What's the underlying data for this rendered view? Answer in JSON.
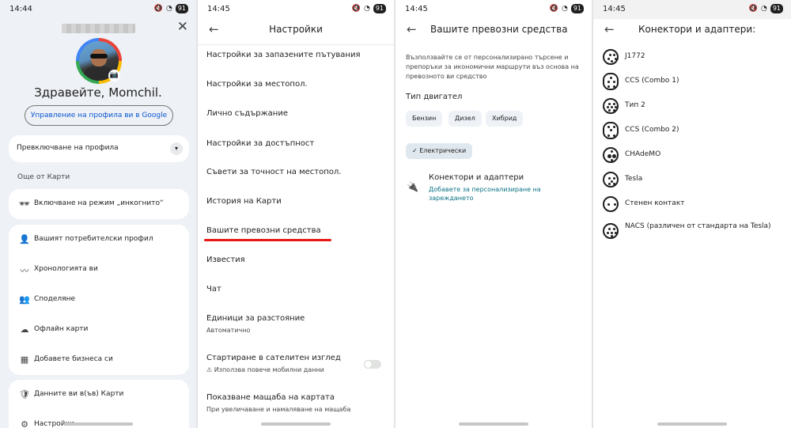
{
  "panel1": {
    "status": {
      "time": "14:44",
      "battery": "91"
    },
    "greeting": "Здравейте, Momchil.",
    "manage_profile": "Управление на профила ви в Google",
    "switch_profile": "Превключване на профила",
    "more_from_maps": "Още от Карти",
    "incognito": "Включване на режим „инкогнито“",
    "menu_a": [
      {
        "icon": "person-icon",
        "glyph": "👤",
        "label": "Вашият потребителски профил"
      },
      {
        "icon": "timeline-icon",
        "glyph": "〰",
        "label": "Хронологията ви"
      },
      {
        "icon": "share-people-icon",
        "glyph": "👥",
        "label": "Споделяне"
      },
      {
        "icon": "offline-cloud-icon",
        "glyph": "☁",
        "label": "Офлайн карти"
      },
      {
        "icon": "store-icon",
        "glyph": "▦",
        "label": "Добавете бизнеса си"
      }
    ],
    "menu_b": [
      {
        "icon": "shield-icon",
        "glyph": "🛡",
        "label": "Данните ви в(ъв) Карти"
      },
      {
        "icon": "gear-icon",
        "glyph": "⚙",
        "label": "Настройки"
      }
    ]
  },
  "panel2": {
    "status": {
      "time": "14:45",
      "battery": "91"
    },
    "title": "Настройки",
    "items": [
      "Настройки за запазените пътувания",
      "Настройки за местопол.",
      "Лично съдържание",
      "Настройки за достъпност",
      "Съвети за точност на местопол.",
      "История на Карти",
      "Вашите превозни средства",
      "Известия",
      "Чат"
    ],
    "distance_units": "Единици за разстояние",
    "distance_units_value": "Автоматично",
    "satellite": "Стартиране в сателитен изглед",
    "satellite_sub": "⚠ Използва повече мобилни данни",
    "satellite_on": false,
    "scale": "Показване мащаба на картата",
    "scale_sub": "При увеличаване и намаляване на мащаба"
  },
  "panel3": {
    "status": {
      "time": "14:45",
      "battery": "91"
    },
    "title": "Вашите превозни средства",
    "description": "Възползвайте се от персонализирано търсене и препоръки за икономични маршрути въз основа на превозното ви средство",
    "engine_type": "Тип двигател",
    "chips": [
      "Бензин",
      "Дизел",
      "Хибрид"
    ],
    "electric": "✓ Електрически",
    "connectors_title": "Конектори и адаптери",
    "connectors_link": "Добавете за персонализиране на зареждането"
  },
  "panel4": {
    "status": {
      "time": "14:45",
      "battery": "91"
    },
    "title": "Конектори и адаптери:",
    "connectors": [
      "J1772",
      "CCS (Combo 1)",
      "Тип 2",
      "CCS (Combo 2)",
      "CHAdeMO",
      "Tesla",
      "Стенен контакт",
      "NACS (различен от стандарта на Tesla)"
    ]
  }
}
